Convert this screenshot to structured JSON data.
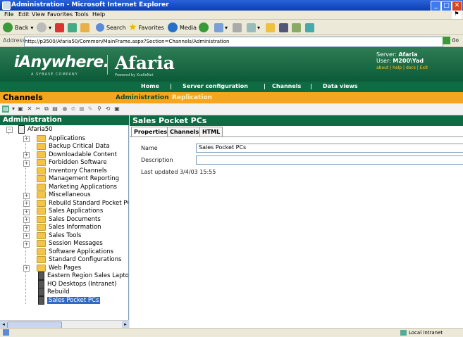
{
  "window": {
    "title": "Administration - Microsoft Internet Explorer"
  },
  "menu": [
    "File",
    "Edit",
    "View",
    "Favorites",
    "Tools",
    "Help"
  ],
  "toolbar": {
    "back": "Back",
    "search": "Search",
    "favorites": "Favorites",
    "media": "Media"
  },
  "address": {
    "label": "Address",
    "url": "http://p3500/Afaria50/Common/MainFrame.aspx?Section=Channels/Administration",
    "go": "Go"
  },
  "header": {
    "brand1": "iAnywhere.",
    "brand1_sub": "A SYBASE COMPANY",
    "brand2": "Afaria",
    "brand2_sub": "Powered by XcelleNet",
    "server_label": "Server:",
    "server": "Afaria",
    "user_label": "User:",
    "user": "M200\\Yad",
    "links": "about | help | docs | Exit"
  },
  "nav": {
    "home": "Home",
    "server_config": "Server configuration",
    "channels": "Channels",
    "data_views": "Data views",
    "sep": "|"
  },
  "section": {
    "title": "Channels",
    "admin": "Administration",
    "replication": "Replication"
  },
  "left": {
    "header": "Administration",
    "root": "Afaria50",
    "items": [
      {
        "label": "Applications",
        "expand": true,
        "type": "folder"
      },
      {
        "label": "Backup Critical Data",
        "expand": false,
        "type": "folder"
      },
      {
        "label": "Downloadable Content",
        "expand": true,
        "type": "folder"
      },
      {
        "label": "Forbidden Software",
        "expand": true,
        "type": "folder"
      },
      {
        "label": "Inventory Channels",
        "expand": false,
        "type": "folder"
      },
      {
        "label": "Management Reporting",
        "expand": false,
        "type": "folder"
      },
      {
        "label": "Marketing Applications",
        "expand": false,
        "type": "folder"
      },
      {
        "label": "Miscellaneous",
        "expand": true,
        "type": "folder"
      },
      {
        "label": "Rebuild Standard Pocket PC",
        "expand": true,
        "type": "folder"
      },
      {
        "label": "Sales Applications",
        "expand": true,
        "type": "folder"
      },
      {
        "label": "Sales Documents",
        "expand": true,
        "type": "folder"
      },
      {
        "label": "Sales Information",
        "expand": true,
        "type": "folder"
      },
      {
        "label": "Sales Tools",
        "expand": true,
        "type": "folder"
      },
      {
        "label": "Session Messages",
        "expand": true,
        "type": "folder"
      },
      {
        "label": "Software Applications",
        "expand": false,
        "type": "folder"
      },
      {
        "label": "Standard Configurations",
        "expand": false,
        "type": "folder"
      },
      {
        "label": "Web Pages",
        "expand": true,
        "type": "folder"
      },
      {
        "label": "Eastern Region Sales Lapto",
        "expand": false,
        "type": "device"
      },
      {
        "label": "HQ Desktops (Intranet)",
        "expand": false,
        "type": "device"
      },
      {
        "label": "Rebuild",
        "expand": false,
        "type": "device"
      },
      {
        "label": "Sales Pocket PCs",
        "expand": false,
        "type": "device",
        "selected": true
      }
    ]
  },
  "right": {
    "header": "Sales Pocket PCs",
    "tabs": [
      "Properties",
      "Channels",
      "HTML"
    ],
    "name_label": "Name",
    "name_value": "Sales Pocket PCs",
    "desc_label": "Description",
    "desc_value": "",
    "last_updated": "Last updated 3/4/03 15:55"
  },
  "status": {
    "zone": "Local intranet"
  }
}
